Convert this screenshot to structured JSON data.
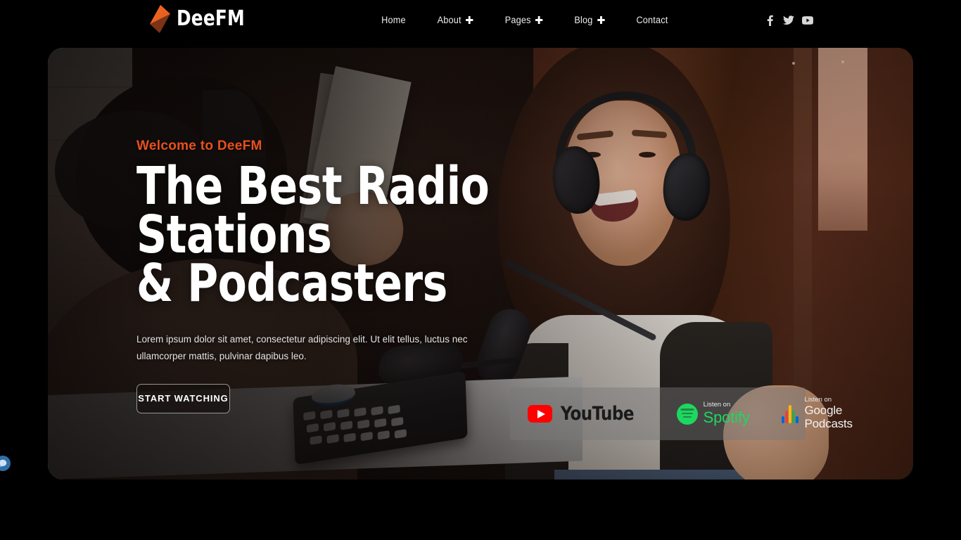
{
  "site": {
    "brand_name": "DeeFM",
    "logo_icon": "diamond-logo-icon",
    "accent_color": "#e8501e",
    "background_color": "#000000"
  },
  "header": {
    "nav": [
      {
        "label": "Home",
        "has_dropdown": false
      },
      {
        "label": "About",
        "has_dropdown": true
      },
      {
        "label": "Pages",
        "has_dropdown": true
      },
      {
        "label": "Blog",
        "has_dropdown": true
      },
      {
        "label": "Contact",
        "has_dropdown": false
      }
    ],
    "socials": [
      {
        "name": "facebook-icon"
      },
      {
        "name": "twitter-icon"
      },
      {
        "name": "youtube-icon"
      }
    ]
  },
  "hero": {
    "eyebrow": "Welcome to DeeFM",
    "title_line1": "The Best Radio Stations",
    "title_line2": "& Podcasters",
    "description": "Lorem ipsum dolor sit amet, consectetur adipiscing elit. Ut elit tellus, luctus nec ullamcorper mattis, pulvinar dapibus leo.",
    "cta_label": "START WATCHING",
    "image_alt": "Woman wearing headphones smiling in a podcast studio with microphone and mixing console"
  },
  "platforms": [
    {
      "id": "youtube",
      "icon": "youtube-play-icon",
      "kicker": "",
      "name": "YouTube",
      "color": "#ff0000"
    },
    {
      "id": "spotify",
      "icon": "spotify-icon",
      "kicker": "Listen on",
      "name": "Spotify",
      "color": "#1ed760"
    },
    {
      "id": "google-podcasts",
      "icon": "google-podcasts-icon",
      "kicker": "Listen on",
      "name": "Google Podcasts",
      "color": "#ffffff"
    }
  ],
  "widgets": {
    "chat_icon": "chat-bubble-icon"
  }
}
